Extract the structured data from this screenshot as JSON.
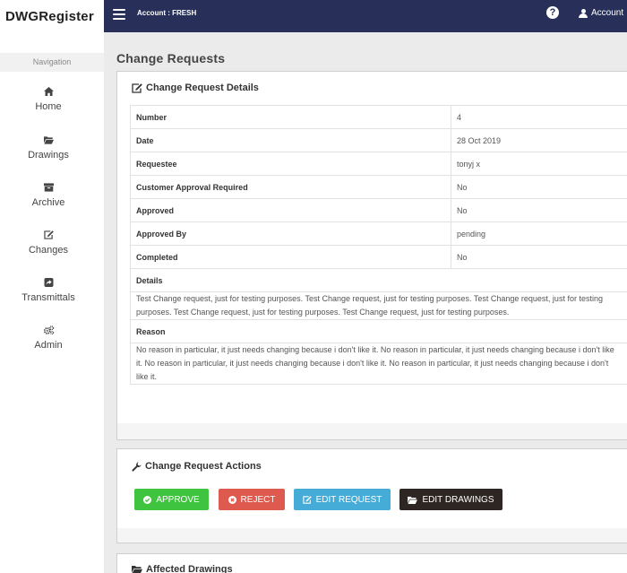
{
  "app": {
    "brand": "DWGRegister",
    "account_label": "Account : FRESH",
    "help_glyph": "?",
    "account_menu": "Account",
    "topbar_color": "#28305a"
  },
  "sidebar": {
    "header": "Navigation",
    "items": [
      {
        "label": "Home",
        "icon": "home-icon"
      },
      {
        "label": "Drawings",
        "icon": "folder-open-icon"
      },
      {
        "label": "Archive",
        "icon": "archive-icon"
      },
      {
        "label": "Changes",
        "icon": "edit-icon"
      },
      {
        "label": "Transmittals",
        "icon": "share-icon"
      },
      {
        "label": "Admin",
        "icon": "cogs-icon"
      }
    ]
  },
  "page": {
    "title": "Change Requests"
  },
  "details_panel": {
    "heading": "Change Request Details",
    "rows": [
      {
        "label": "Number",
        "value": "4"
      },
      {
        "label": "Date",
        "value": "28 Oct 2019"
      },
      {
        "label": "Requestee",
        "value": "tonyj x"
      },
      {
        "label": "Customer Approval Required",
        "value": "No"
      },
      {
        "label": "Approved",
        "value": "No"
      },
      {
        "label": "Approved By",
        "value": "pending"
      },
      {
        "label": "Completed",
        "value": "No"
      }
    ],
    "details_label": "Details",
    "details_text": "Test Change request, just for testing purposes. Test Change request, just for testing purposes. Test Change request, just for testing purposes. Test Change request, just for testing purposes. Test Change request, just for testing purposes.",
    "reason_label": "Reason",
    "reason_text": "No reason in particular, it just needs changing because i don't like it. No reason in particular, it just needs changing because i don't like it. No reason in particular, it just needs changing because i don't like it. No reason in particular, it just needs changing because i don't like it."
  },
  "actions_panel": {
    "heading": "Change Request Actions",
    "buttons": {
      "approve": {
        "label": "APPROVE",
        "color": "#3fc43f"
      },
      "reject": {
        "label": "REJECT",
        "color": "#de5a4e"
      },
      "edit_request": {
        "label": "EDIT REQUEST",
        "color": "#45acd8"
      },
      "edit_drawings": {
        "label": "EDIT DRAWINGS",
        "color": "#2e2623"
      }
    }
  },
  "affected_panel": {
    "heading": "Affected Drawings"
  }
}
